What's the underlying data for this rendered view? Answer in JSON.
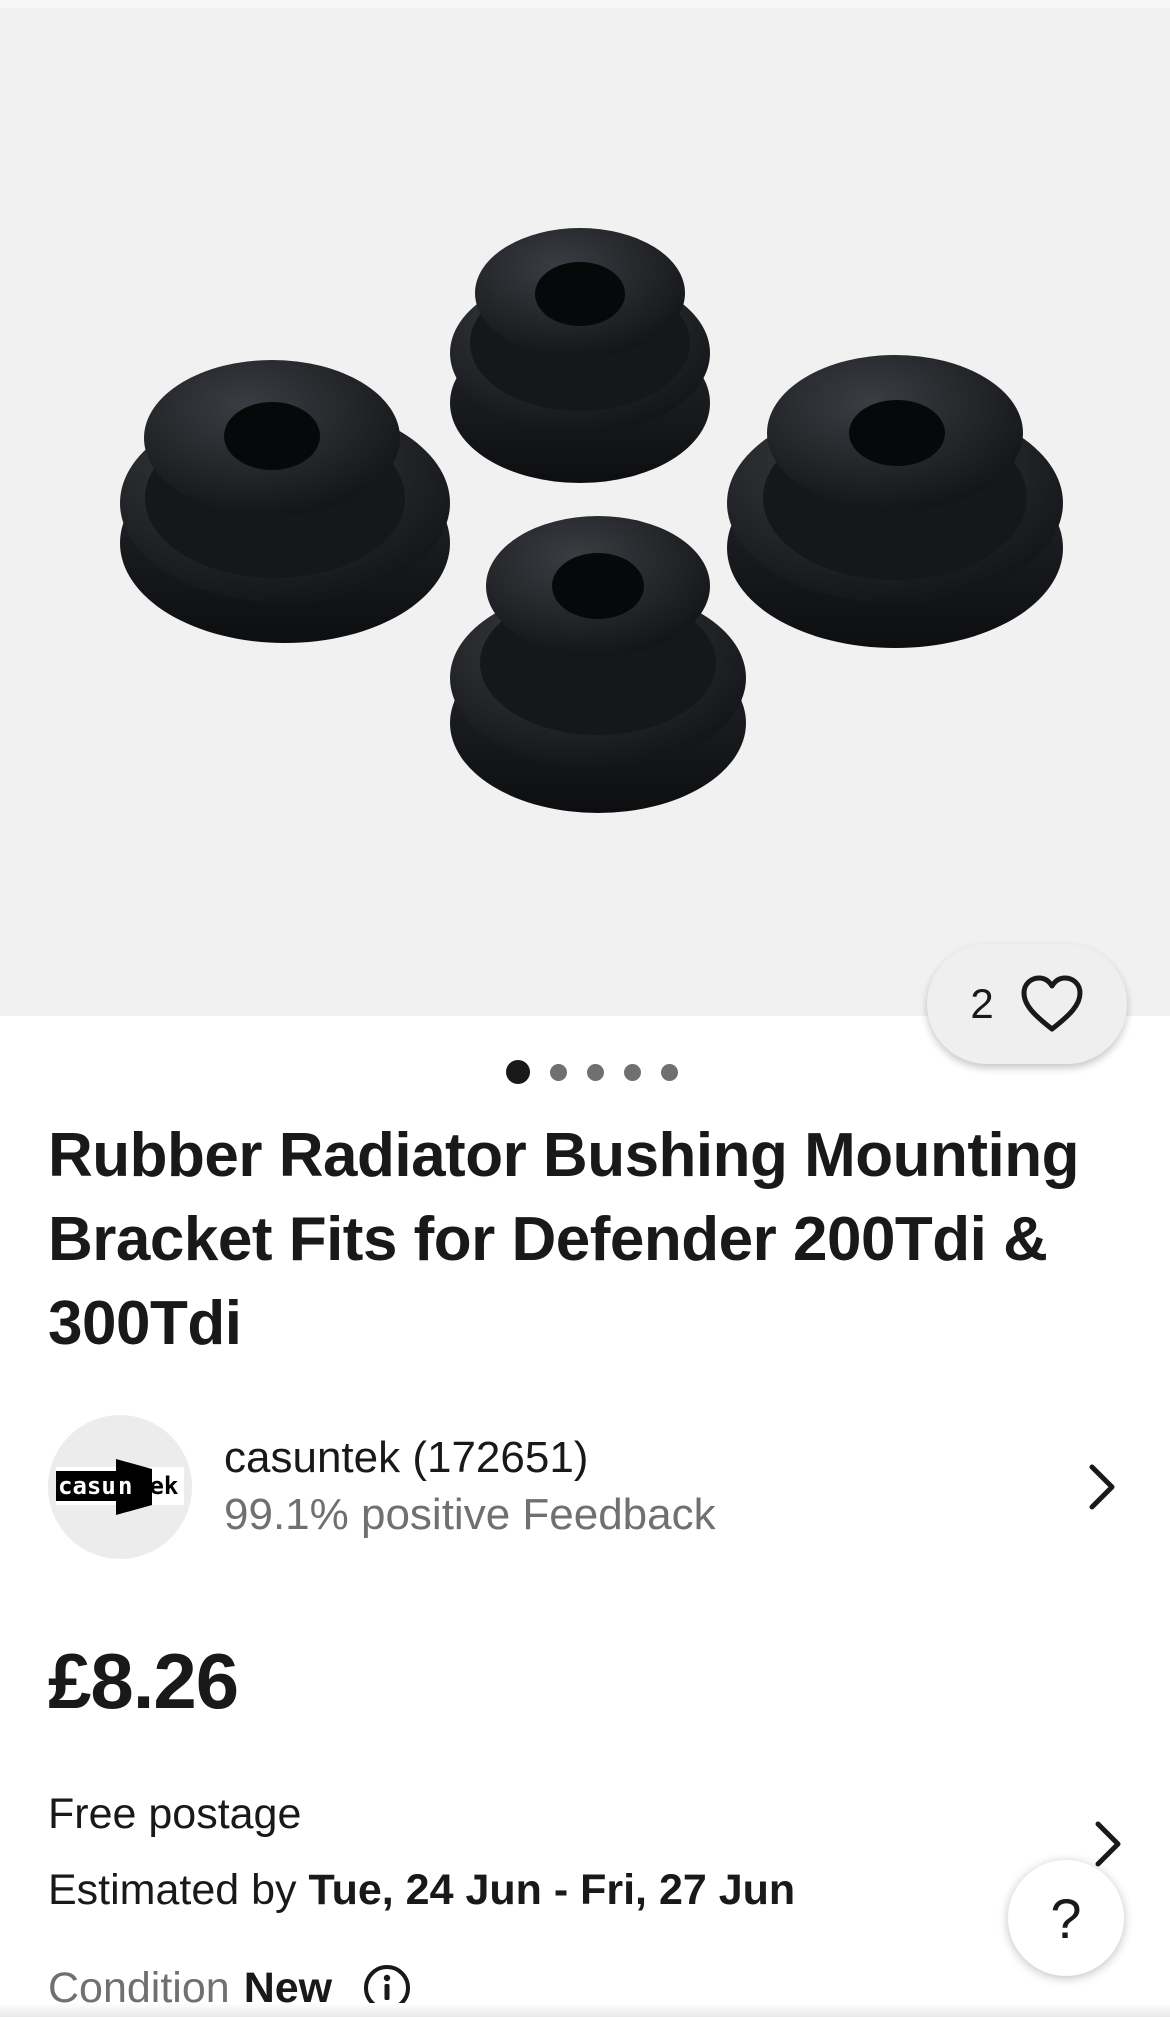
{
  "gallery": {
    "image_name": "rubber-bushings-photo",
    "watch_count": "2",
    "watch_icon": "heart-outline-icon",
    "pages_total": 5,
    "current_page": 1
  },
  "listing": {
    "title": "Rubber Radiator Bushing Mounting Bracket Fits for Defender 200Tdi & 300Tdi"
  },
  "seller": {
    "logo_text_left": "casu",
    "logo_text_right": "tek",
    "name": "casuntek (172651)",
    "feedback": "99.1% positive Feedback",
    "chevron_icon": "chevron-right-icon"
  },
  "price": {
    "amount": "£8.26"
  },
  "postage": {
    "free": "Free postage",
    "estimate_prefix": "Estimated by",
    "estimate_dates": "Tue, 24 Jun - Fri, 27 Jun"
  },
  "help": {
    "label": "?"
  },
  "condition": {
    "label": "Condition",
    "value": "New",
    "info_icon": "info-circle-icon"
  },
  "colors": {
    "text": "#191919",
    "secondary": "#707070",
    "gallery_bg": "#f1f1f1"
  }
}
